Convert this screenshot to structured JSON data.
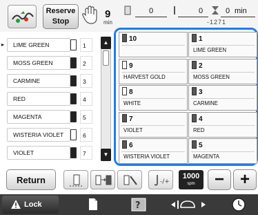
{
  "header": {
    "reserve_stop_label_1": "Reserve",
    "reserve_stop_label_2": "Stop",
    "remaining_colors": "9",
    "min_label": "min",
    "stat1_value": "0",
    "stat2_value": "0",
    "stat3_value": "0",
    "stat3_unit": "min",
    "stitch_counter": "-1271"
  },
  "color_list": [
    {
      "name": "LIME GREEN",
      "num": "1",
      "current": true,
      "spool": "light"
    },
    {
      "name": "MOSS GREEN",
      "num": "2",
      "current": false,
      "spool": "dark"
    },
    {
      "name": "CARMINE",
      "num": "3",
      "current": false,
      "spool": "dark"
    },
    {
      "name": "RED",
      "num": "4",
      "current": false,
      "spool": "dark"
    },
    {
      "name": "MAGENTA",
      "num": "5",
      "current": false,
      "spool": "dark"
    },
    {
      "name": "WISTERIA VIOLET",
      "num": "6",
      "current": false,
      "spool": "light"
    },
    {
      "name": "VIOLET",
      "num": "7",
      "current": false,
      "spool": "dark"
    }
  ],
  "current_marker": "▸",
  "scroll": {
    "up": "▲",
    "down": "▼"
  },
  "needle_grid": [
    {
      "num": "10",
      "label": "",
      "spool": "dark"
    },
    {
      "num": "1",
      "label": "LIME GREEN",
      "spool": "dark"
    },
    {
      "num": "9",
      "label": "HARVEST GOLD",
      "spool": "light"
    },
    {
      "num": "2",
      "label": "MOSS GREEN",
      "spool": "dark"
    },
    {
      "num": "8",
      "label": "WHITE",
      "spool": "light"
    },
    {
      "num": "3",
      "label": "CARMINE",
      "spool": "dark"
    },
    {
      "num": "7",
      "label": "VIOLET",
      "spool": "dark"
    },
    {
      "num": "4",
      "label": "RED",
      "spool": "dark"
    },
    {
      "num": "6",
      "label": "WISTERIA VIOLET",
      "spool": "dark"
    },
    {
      "num": "5",
      "label": "MAGENTA",
      "spool": "dark"
    }
  ],
  "bottom": {
    "return_label": "Return",
    "speed_value": "1000",
    "speed_unit": "spm",
    "minus_label": "−",
    "plus_label": "+",
    "lock_label": "Lock"
  },
  "colors": {
    "panel_border": "#1d7dea",
    "bottom_bar": "#3a3a3a"
  }
}
